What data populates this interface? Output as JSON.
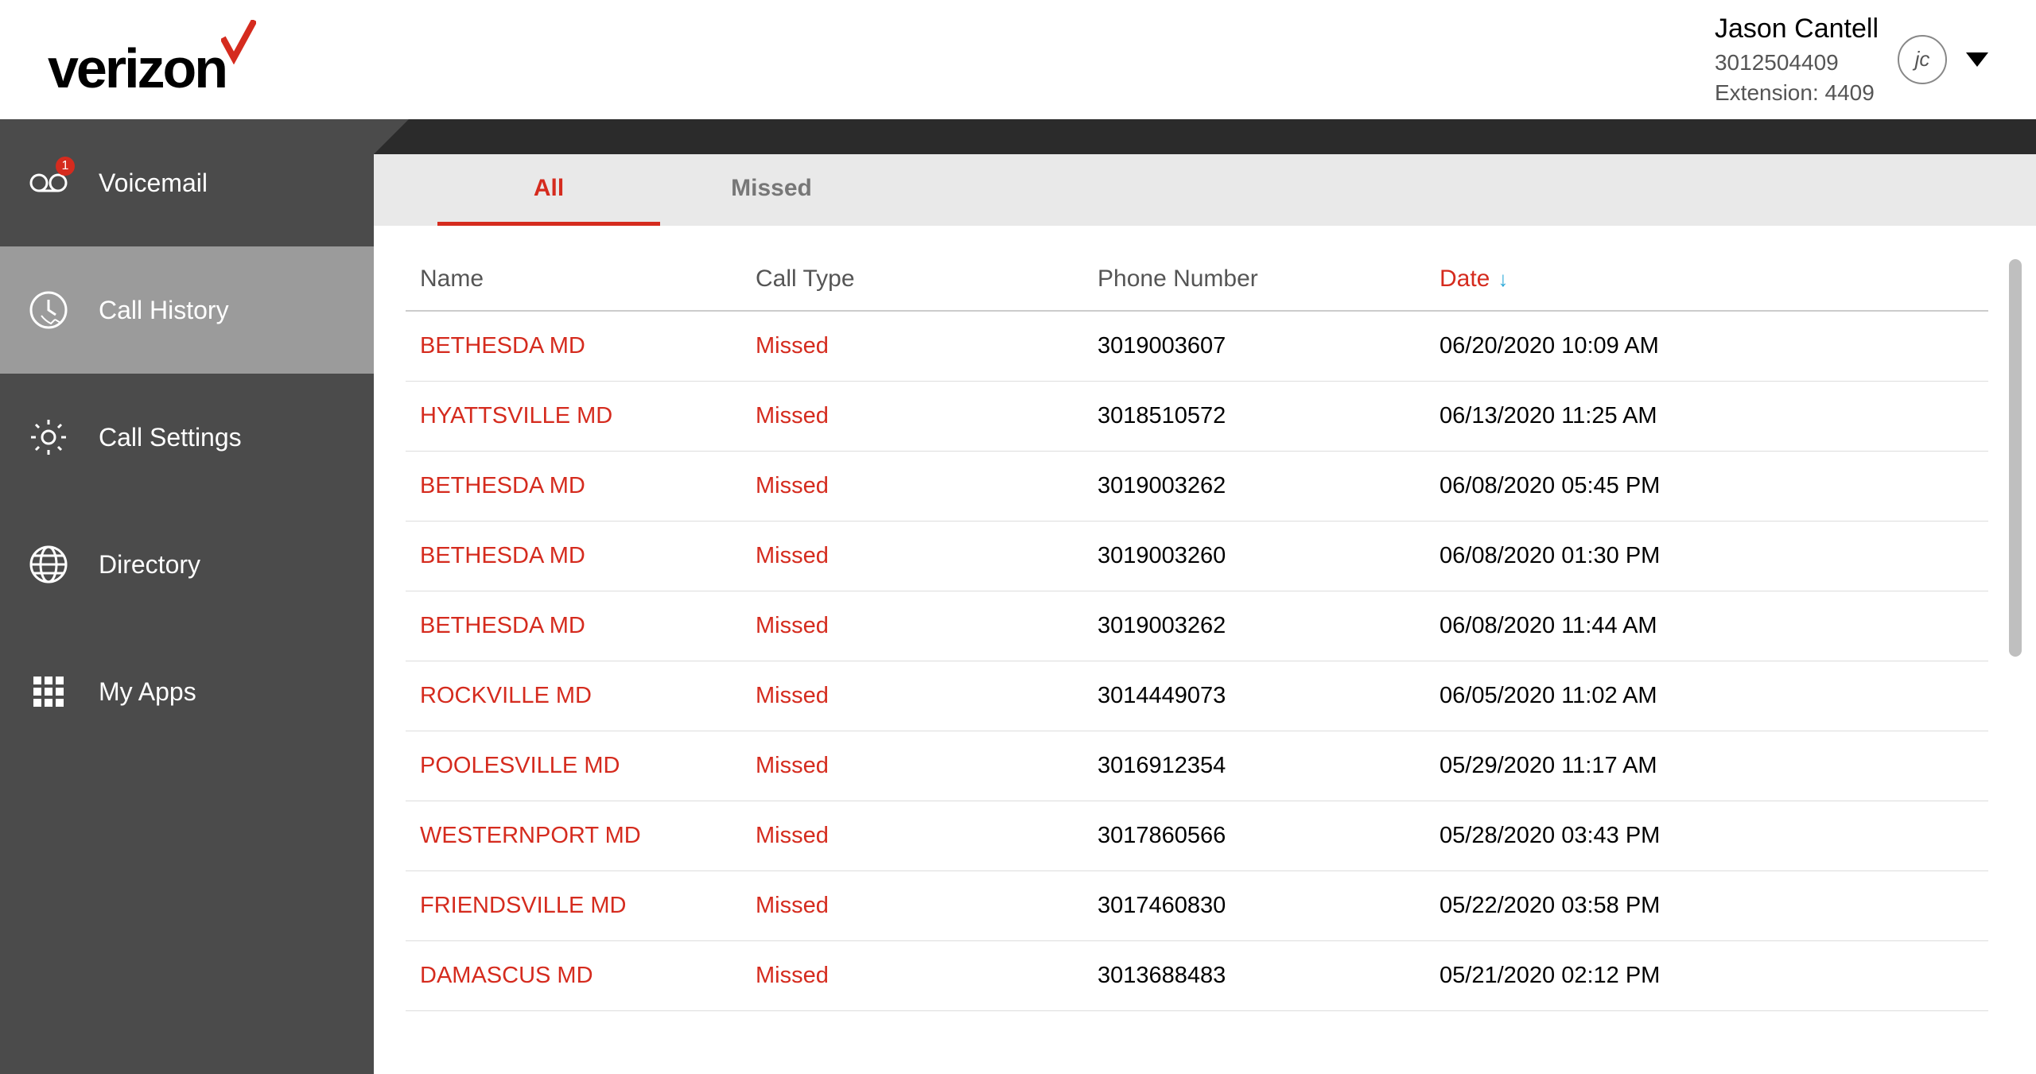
{
  "brand": {
    "name": "verizon"
  },
  "user": {
    "name": "Jason Cantell",
    "phone": "3012504409",
    "extension_label": "Extension: 4409",
    "initials": "jc"
  },
  "sidebar": {
    "items": [
      {
        "label": "Voicemail",
        "icon": "voicemail-icon",
        "badge": "1",
        "active": false
      },
      {
        "label": "Call History",
        "icon": "call-history-icon",
        "badge": null,
        "active": true
      },
      {
        "label": "Call Settings",
        "icon": "gear-icon",
        "badge": null,
        "active": false
      },
      {
        "label": "Directory",
        "icon": "globe-icon",
        "badge": null,
        "active": false
      },
      {
        "label": "My Apps",
        "icon": "apps-grid-icon",
        "badge": null,
        "active": false
      }
    ]
  },
  "tabs": [
    {
      "label": "All",
      "active": true
    },
    {
      "label": "Missed",
      "active": false
    }
  ],
  "table": {
    "headers": {
      "name": "Name",
      "call_type": "Call Type",
      "phone": "Phone Number",
      "date": "Date"
    },
    "sort": {
      "column": "date",
      "direction": "desc"
    },
    "rows": [
      {
        "name": "BETHESDA MD",
        "call_type": "Missed",
        "phone": "3019003607",
        "date": "06/20/2020 10:09 AM"
      },
      {
        "name": "HYATTSVILLE MD",
        "call_type": "Missed",
        "phone": "3018510572",
        "date": "06/13/2020 11:25 AM"
      },
      {
        "name": "BETHESDA MD",
        "call_type": "Missed",
        "phone": "3019003262",
        "date": "06/08/2020 05:45 PM"
      },
      {
        "name": "BETHESDA MD",
        "call_type": "Missed",
        "phone": "3019003260",
        "date": "06/08/2020 01:30 PM"
      },
      {
        "name": "BETHESDA MD",
        "call_type": "Missed",
        "phone": "3019003262",
        "date": "06/08/2020 11:44 AM"
      },
      {
        "name": "ROCKVILLE MD",
        "call_type": "Missed",
        "phone": "3014449073",
        "date": "06/05/2020 11:02 AM"
      },
      {
        "name": "POOLESVILLE MD",
        "call_type": "Missed",
        "phone": "3016912354",
        "date": "05/29/2020 11:17 AM"
      },
      {
        "name": "WESTERNPORT MD",
        "call_type": "Missed",
        "phone": "3017860566",
        "date": "05/28/2020 03:43 PM"
      },
      {
        "name": "FRIENDSVILLE MD",
        "call_type": "Missed",
        "phone": "3017460830",
        "date": "05/22/2020 03:58 PM"
      },
      {
        "name": "DAMASCUS MD",
        "call_type": "Missed",
        "phone": "3013688483",
        "date": "05/21/2020 02:12 PM"
      }
    ]
  },
  "colors": {
    "accent_red": "#d52b1e",
    "sort_arrow": "#2aa8d8",
    "sidebar_bg": "#4b4b4b",
    "sidebar_active_bg": "#9b9b9b"
  }
}
